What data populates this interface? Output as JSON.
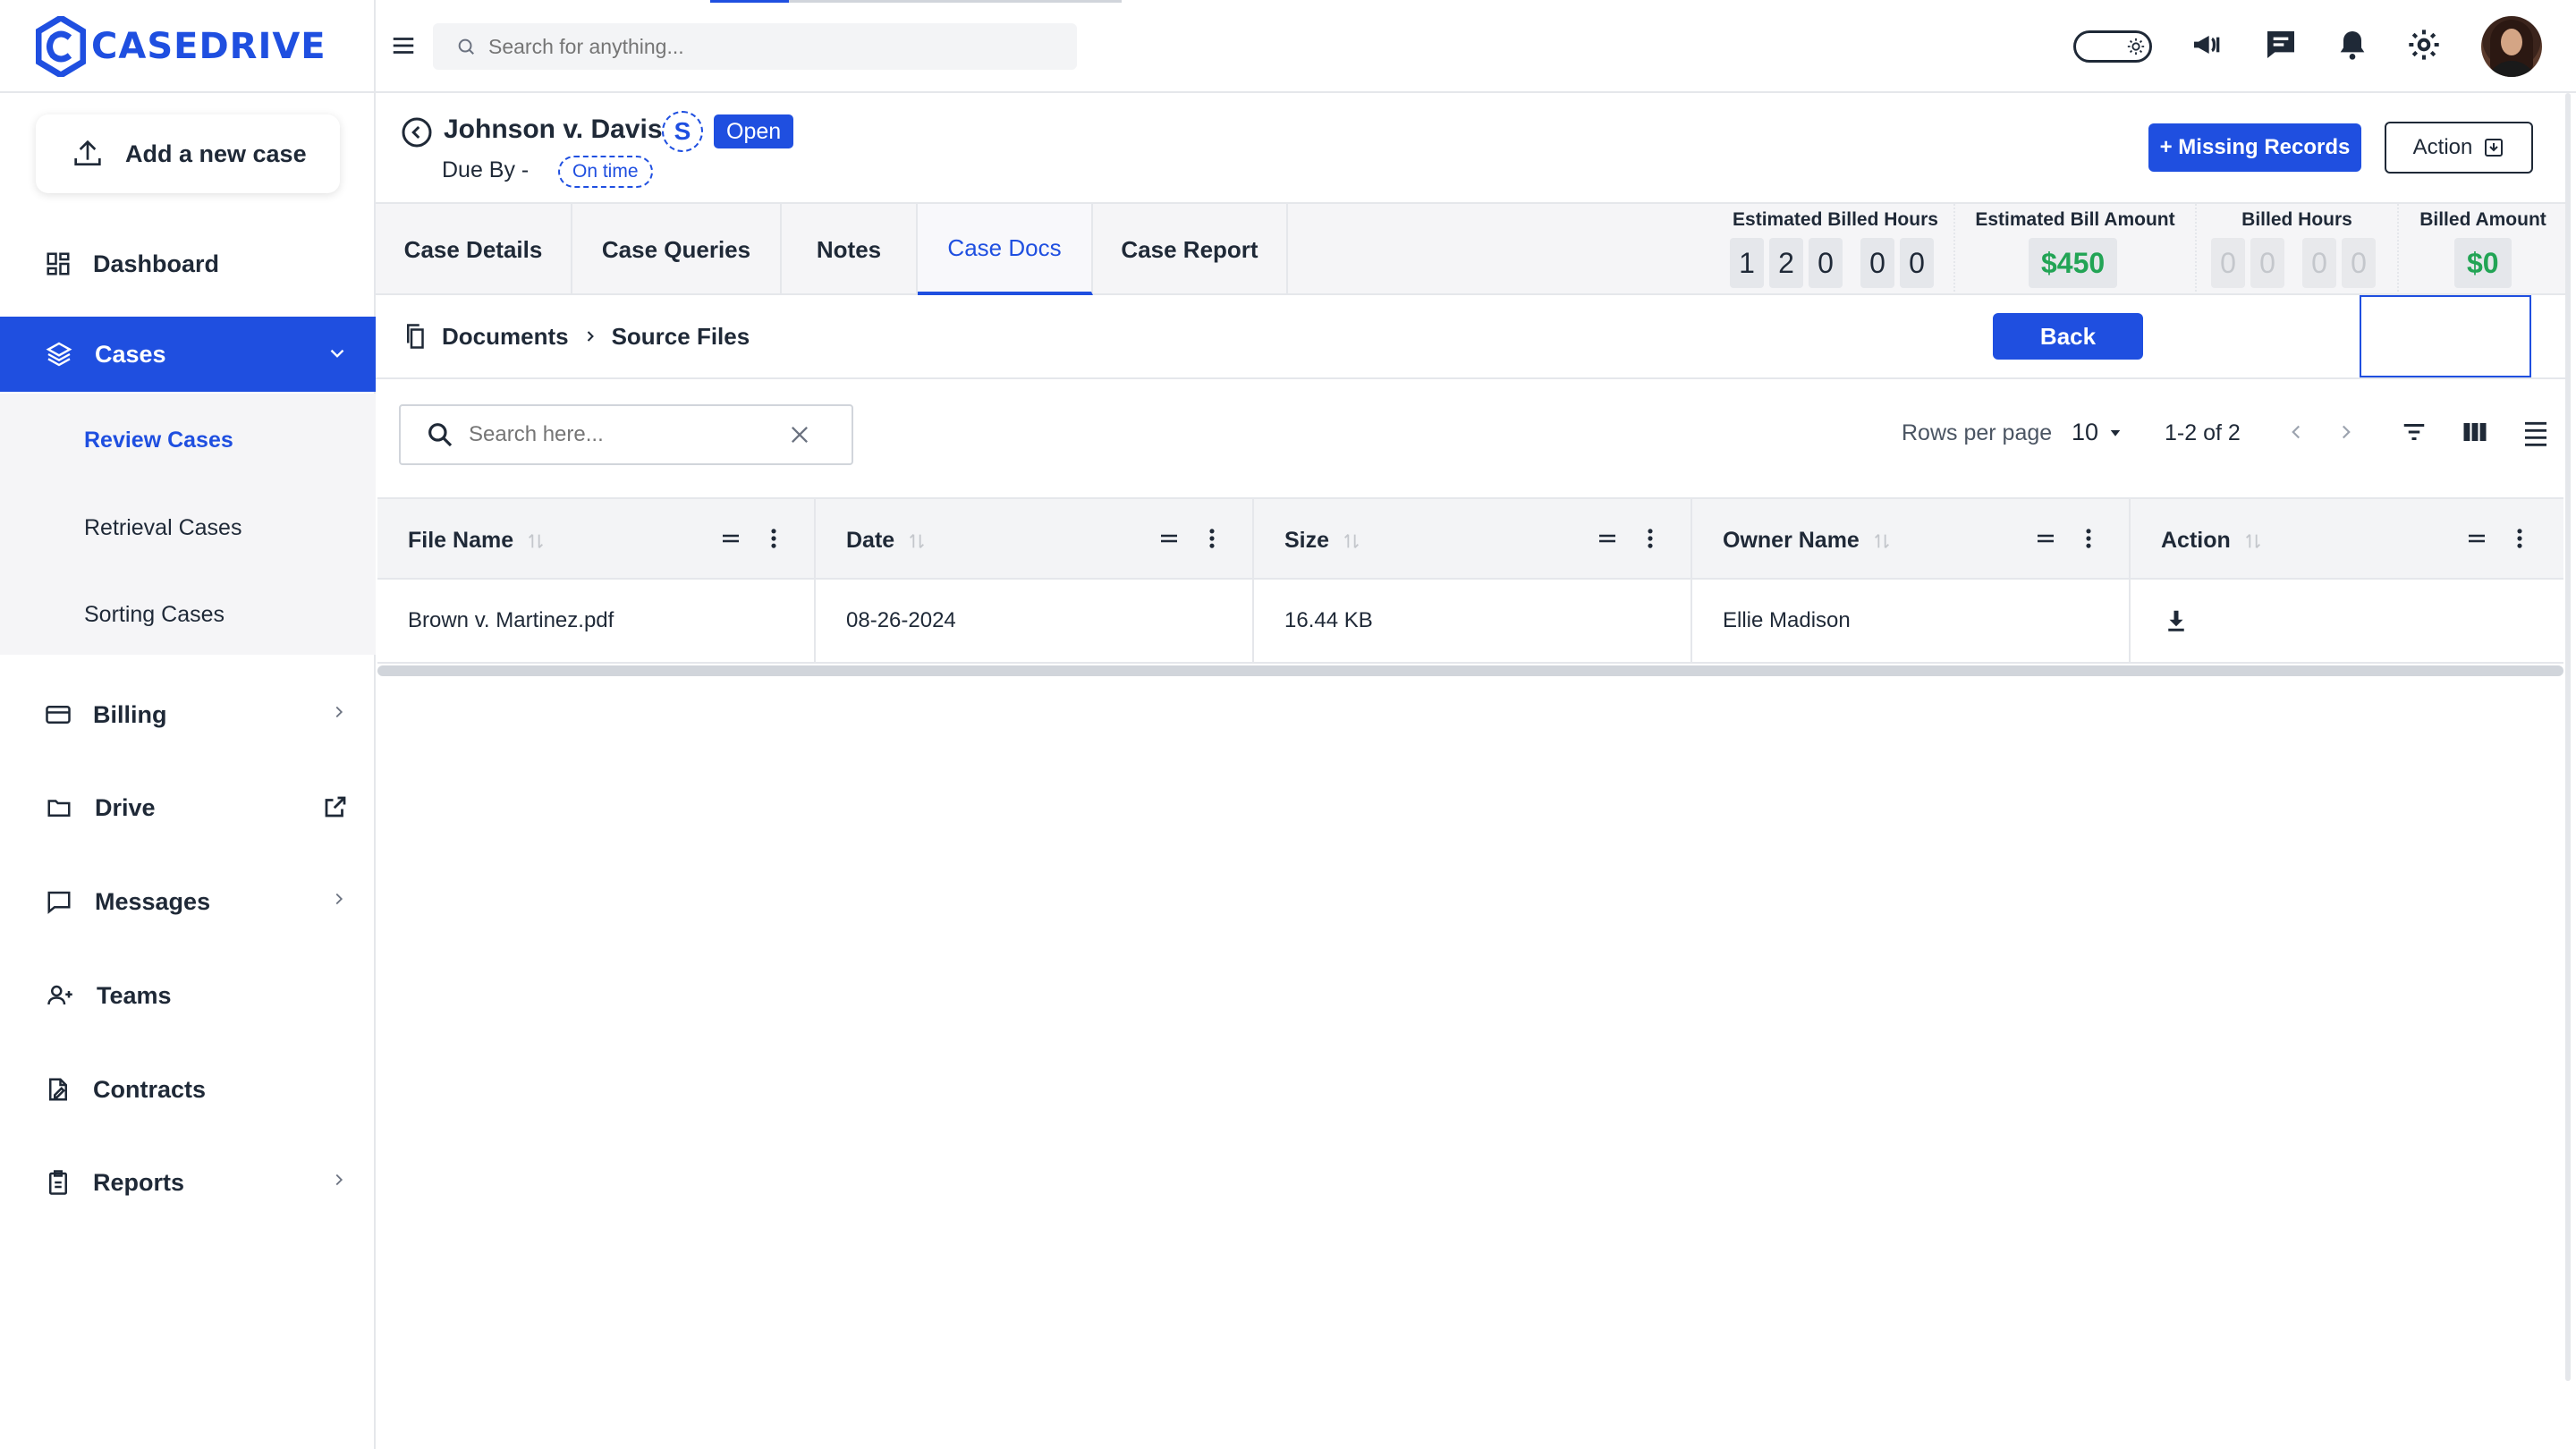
{
  "brand": {
    "name": "CASEDRIVE",
    "color": "#1f4fe0"
  },
  "sidebar": {
    "add_case_label": "Add a new case",
    "items": [
      {
        "label": "Dashboard",
        "icon": "dashboard-icon"
      },
      {
        "label": "Cases",
        "icon": "layers-icon",
        "active": true
      },
      {
        "label": "Billing",
        "icon": "credit-card-icon"
      },
      {
        "label": "Drive",
        "icon": "folder-icon"
      },
      {
        "label": "Messages",
        "icon": "message-icon"
      },
      {
        "label": "Teams",
        "icon": "users-icon"
      },
      {
        "label": "Contracts",
        "icon": "contract-icon"
      },
      {
        "label": "Reports",
        "icon": "clipboard-icon"
      }
    ],
    "cases_sub": [
      "Review Cases",
      "Retrieval Cases",
      "Sorting Cases"
    ]
  },
  "topbar": {
    "search_placeholder": "Search for anything..."
  },
  "case": {
    "title": "Johnson v. Davis",
    "initial": "S",
    "status": "Open",
    "due_by_label": "Due By -",
    "due_status": "On time",
    "missing_records_label": "+ Missing Records",
    "action_label": "Action"
  },
  "tabs": [
    "Case Details",
    "Case Queries",
    "Notes",
    "Case Docs",
    "Case Report"
  ],
  "metrics": {
    "est_hours_label": "Estimated Billed Hours",
    "est_hours_digits": [
      "1",
      "2",
      "0",
      "0",
      "0"
    ],
    "est_amount_label": "Estimated Bill Amount",
    "est_amount": "$450",
    "billed_hours_label": "Billed Hours",
    "billed_hours_digits": [
      "0",
      "0",
      "0",
      "0"
    ],
    "billed_amount_label": "Billed Amount",
    "billed_amount": "$0"
  },
  "breadcrumb": {
    "root": "Documents",
    "current": "Source Files"
  },
  "back_label": "Back",
  "table_toolbar": {
    "search_placeholder": "Search here...",
    "rows_per_page_label": "Rows per page",
    "rows_per_page": "10",
    "range": "1-2 of 2"
  },
  "table": {
    "columns": [
      "File Name",
      "Date",
      "Size",
      "Owner Name",
      "Action"
    ],
    "rows": [
      {
        "file_name": "Brown v. Martinez.pdf",
        "date": "08-26-2024",
        "size": "16.44 KB",
        "owner": "Ellie Madison"
      }
    ]
  }
}
